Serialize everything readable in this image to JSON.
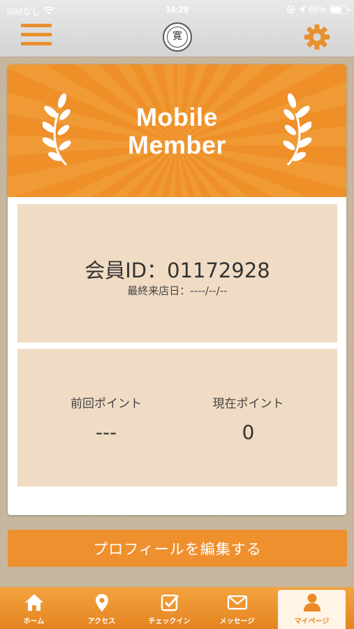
{
  "status_bar": {
    "carrier": "SIMなし",
    "time": "14:29",
    "battery": "66%",
    "battery_level": 0.66
  },
  "header": {
    "logo_char": "寛",
    "menu_icon": "hamburger-icon",
    "settings_icon": "gear-icon"
  },
  "banner": {
    "title_line1": "Mobile",
    "title_line2": "Member"
  },
  "member": {
    "id_text": "会員ID：01172928",
    "last_visit": "最終来店日：----/--/--"
  },
  "points": {
    "previous_label": "前回ポイント",
    "previous_value": "---",
    "current_label": "現在ポイント",
    "current_value": "0"
  },
  "edit_profile_label": "プロフィールを編集する",
  "tabs": [
    {
      "label": "ホーム",
      "icon": "home-icon",
      "active": false
    },
    {
      "label": "アクセス",
      "icon": "map-pin-icon",
      "active": false
    },
    {
      "label": "チェックイン",
      "icon": "checkbox-icon",
      "active": false
    },
    {
      "label": "メッセージ",
      "icon": "mail-icon",
      "active": false
    },
    {
      "label": "マイページ",
      "icon": "person-icon",
      "active": true
    }
  ],
  "colors": {
    "accent": "#ee902e",
    "panel": "#f0dcc4",
    "active_tab_bg": "#fff4e6"
  }
}
